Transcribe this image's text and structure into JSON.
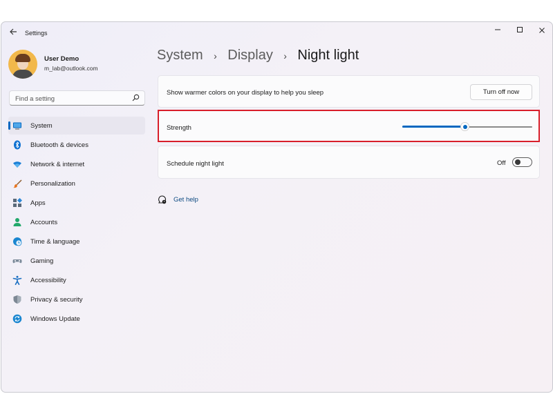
{
  "window": {
    "title": "Settings",
    "back_icon": "back-arrow-icon",
    "controls": {
      "minimize": "–",
      "maximize": "☐",
      "close": "✕"
    }
  },
  "profile": {
    "name": "User Demo",
    "email": "m_lab@outlook.com"
  },
  "search": {
    "placeholder": "Find a setting",
    "icon": "search-icon"
  },
  "sidebar": {
    "items": [
      {
        "label": "System",
        "icon": "system-icon",
        "active": true
      },
      {
        "label": "Bluetooth & devices",
        "icon": "bluetooth-icon"
      },
      {
        "label": "Network & internet",
        "icon": "wifi-icon"
      },
      {
        "label": "Personalization",
        "icon": "brush-icon"
      },
      {
        "label": "Apps",
        "icon": "apps-icon"
      },
      {
        "label": "Accounts",
        "icon": "account-icon"
      },
      {
        "label": "Time & language",
        "icon": "globe-clock-icon"
      },
      {
        "label": "Gaming",
        "icon": "gamepad-icon"
      },
      {
        "label": "Accessibility",
        "icon": "accessibility-icon"
      },
      {
        "label": "Privacy & security",
        "icon": "shield-icon"
      },
      {
        "label": "Windows Update",
        "icon": "update-icon"
      }
    ]
  },
  "breadcrumb": {
    "items": [
      "System",
      "Display",
      "Night light"
    ],
    "separator": "›"
  },
  "settings": {
    "warm_colors": {
      "label": "Show warmer colors on your display to help you sleep",
      "button": "Turn off now"
    },
    "strength": {
      "label": "Strength",
      "value_fraction": 0.48
    },
    "schedule": {
      "label": "Schedule night light",
      "state": "Off"
    }
  },
  "help": {
    "label": "Get help",
    "icon": "help-icon"
  },
  "colors": {
    "accent": "#0067c0",
    "highlight": "#d81e2a",
    "link": "#0e4b82"
  }
}
